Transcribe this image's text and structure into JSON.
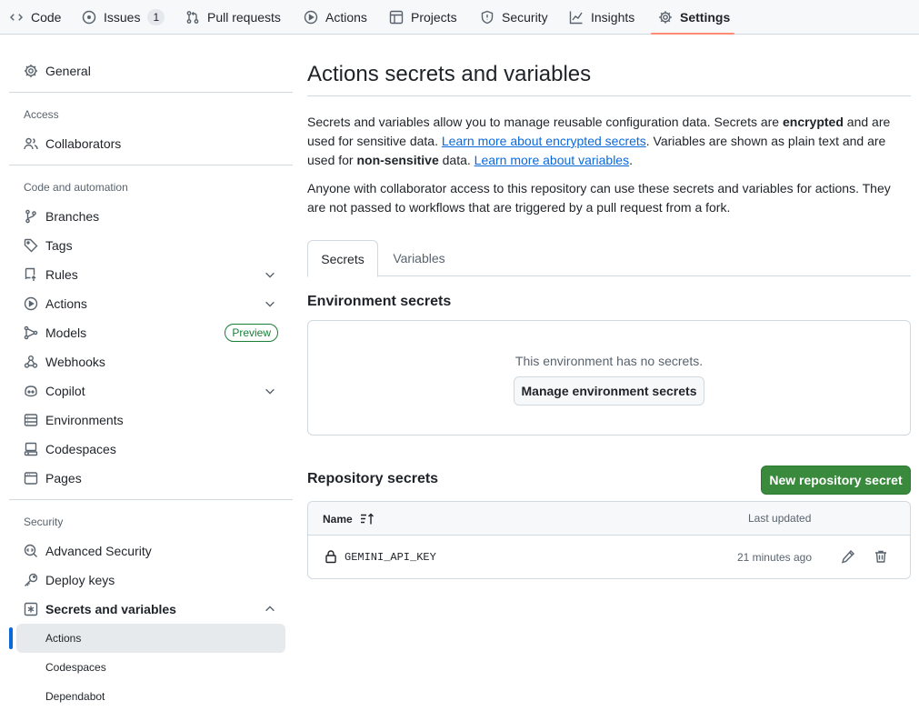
{
  "topnav": {
    "tabs": [
      {
        "label": "Code",
        "icon": "code-icon"
      },
      {
        "label": "Issues",
        "icon": "issue-opened-icon",
        "count": "1"
      },
      {
        "label": "Pull requests",
        "icon": "git-pull-request-icon"
      },
      {
        "label": "Actions",
        "icon": "play-icon"
      },
      {
        "label": "Projects",
        "icon": "table-icon"
      },
      {
        "label": "Security",
        "icon": "shield-icon"
      },
      {
        "label": "Insights",
        "icon": "graph-icon"
      },
      {
        "label": "Settings",
        "icon": "gear-icon",
        "selected": true
      }
    ],
    "selected_underline_color": "#fd8c73"
  },
  "sidebar": {
    "general": "General",
    "sections": {
      "access": "Access",
      "code_automation": "Code and automation",
      "security": "Security"
    },
    "access_items": [
      {
        "label": "Collaborators",
        "icon": "people-icon"
      }
    ],
    "code_items": [
      {
        "label": "Branches",
        "icon": "git-branch-icon"
      },
      {
        "label": "Tags",
        "icon": "tag-icon"
      },
      {
        "label": "Rules",
        "icon": "repo-push-icon",
        "expandable": true
      },
      {
        "label": "Actions",
        "icon": "play-icon",
        "expandable": true
      },
      {
        "label": "Models",
        "icon": "models-icon",
        "badge": "Preview"
      },
      {
        "label": "Webhooks",
        "icon": "webhook-icon"
      },
      {
        "label": "Copilot",
        "icon": "copilot-icon",
        "expandable": true
      },
      {
        "label": "Environments",
        "icon": "server-icon"
      },
      {
        "label": "Codespaces",
        "icon": "codespaces-icon"
      },
      {
        "label": "Pages",
        "icon": "browser-icon"
      }
    ],
    "security_items": [
      {
        "label": "Advanced Security",
        "icon": "codescan-icon"
      },
      {
        "label": "Deploy keys",
        "icon": "key-icon"
      },
      {
        "label": "Secrets and variables",
        "icon": "key-asterisk-icon",
        "expanded": true
      }
    ],
    "secrets_subitems": [
      {
        "label": "Actions",
        "active": true
      },
      {
        "label": "Codespaces"
      },
      {
        "label": "Dependabot"
      }
    ]
  },
  "main": {
    "title": "Actions secrets and variables",
    "intro": {
      "p1_a": "Secrets and variables allow you to manage reusable configuration data. Secrets are ",
      "p1_b": "encrypted",
      "p1_c": " and are used for sensitive data. ",
      "link1": "Learn more about encrypted secrets",
      "p1_d": ". Variables are shown as plain text and are used for ",
      "p1_e": "non-sensitive",
      "p1_f": " data. ",
      "link2": "Learn more about variables",
      "p1_g": "."
    },
    "p2": "Anyone with collaborator access to this repository can use these secrets and variables for actions. They are not passed to workflows that are triggered by a pull request from a fork.",
    "tabs": [
      {
        "label": "Secrets",
        "selected": true
      },
      {
        "label": "Variables"
      }
    ],
    "env_secrets": {
      "heading": "Environment secrets",
      "empty": "This environment has no secrets.",
      "button": "Manage environment secrets"
    },
    "repo_secrets": {
      "heading": "Repository secrets",
      "new_button": "New repository secret",
      "columns": {
        "name": "Name",
        "last_updated": "Last updated"
      },
      "rows": [
        {
          "name": "GEMINI_API_KEY",
          "updated": "21 minutes ago"
        }
      ]
    }
  },
  "colors": {
    "primary_button": "#3a8a3e",
    "link": "#0969da",
    "active_indicator": "#0969da"
  }
}
